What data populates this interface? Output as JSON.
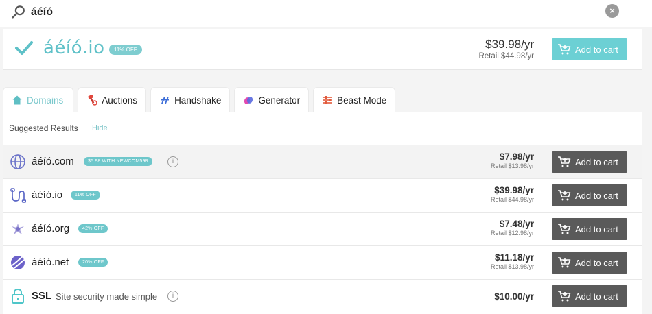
{
  "search": {
    "query": "áéíó",
    "clear_label": "×"
  },
  "top_result": {
    "domain": "áéíó.io",
    "badge": "11% OFF",
    "price": "$39.98/yr",
    "retail": "Retail $44.98/yr",
    "add_to_cart": "Add to cart"
  },
  "tabs": [
    {
      "label": "Domains",
      "icon": "house-icon",
      "active": true
    },
    {
      "label": "Auctions",
      "icon": "auction-icon",
      "active": false
    },
    {
      "label": "Handshake",
      "icon": "handshake-icon",
      "active": false
    },
    {
      "label": "Generator",
      "icon": "generator-icon",
      "active": false
    },
    {
      "label": "Beast Mode",
      "icon": "sliders-icon",
      "active": false
    }
  ],
  "suggested": {
    "heading": "Suggested Results",
    "hide_label": "Hide"
  },
  "rows": [
    {
      "domain": "áéíó.com",
      "badge": "$5.98 WITH NEWCOM598",
      "info": "i",
      "price": "$7.98/yr",
      "retail": "Retail $13.98/yr",
      "add_to_cart": "Add to cart",
      "icon": "globe-icon"
    },
    {
      "domain": "áéíó.io",
      "badge": "11% OFF",
      "price": "$39.98/yr",
      "retail": "Retail $44.98/yr",
      "add_to_cart": "Add to cart",
      "icon": "io-icon"
    },
    {
      "domain": "áéíó.org",
      "badge": "42% OFF",
      "price": "$7.48/yr",
      "retail": "Retail $12.98/yr",
      "add_to_cart": "Add to cart",
      "icon": "org-icon"
    },
    {
      "domain": "áéíó.net",
      "badge": "20% OFF",
      "price": "$11.18/yr",
      "retail": "Retail $13.98/yr",
      "add_to_cart": "Add to cart",
      "icon": "net-icon"
    },
    {
      "domain": "SSL",
      "description": "Site security made simple",
      "info": "i",
      "price": "$10.00/yr",
      "add_to_cart": "Add to cart",
      "icon": "lock-icon"
    }
  ],
  "colors": {
    "teal": "#6cd0d4",
    "dark_button": "#5a5a5a",
    "badge": "#6ec7cb"
  }
}
